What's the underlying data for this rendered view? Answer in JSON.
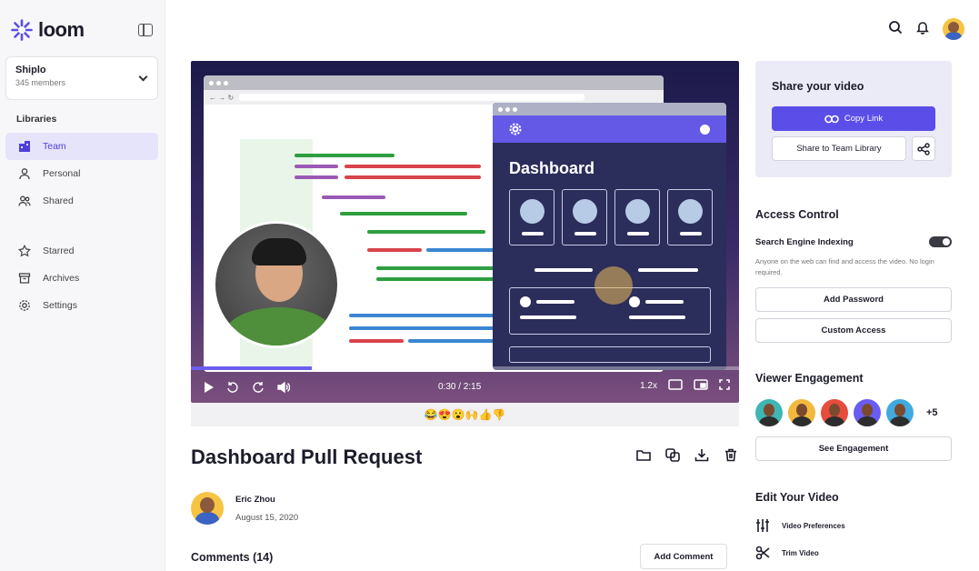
{
  "app": {
    "logo_text": "loom"
  },
  "workspace": {
    "name": "Shiplo",
    "members": "345 members"
  },
  "sidebar": {
    "libraries_label": "Libraries",
    "items": [
      {
        "label": "Team",
        "icon": "building-icon",
        "active": true
      },
      {
        "label": "Personal",
        "icon": "person-icon"
      },
      {
        "label": "Shared",
        "icon": "people-icon"
      },
      {
        "label": "Starred",
        "icon": "star-icon"
      },
      {
        "label": "Archives",
        "icon": "archive-icon"
      },
      {
        "label": "Settings",
        "icon": "gear-icon"
      }
    ]
  },
  "video": {
    "dashboard_title": "Dashboard",
    "time": "0:30 / 2:15",
    "speed": "1.2x",
    "progress": 0.22,
    "reactions": "😂😍😮🙌👍👎"
  },
  "page": {
    "title": "Dashboard Pull Request",
    "author": "Eric Zhou",
    "date": "August 15, 2020",
    "comments_label": "Comments (14)",
    "add_comment": "Add Comment"
  },
  "share": {
    "title": "Share your video",
    "copy_link": "Copy Link",
    "share_team": "Share to Team Library"
  },
  "access": {
    "heading": "Access Control",
    "indexing_label": "Search Engine Indexing",
    "indexing_desc": "Anyone on the web can find and access the video. No login required.",
    "add_password": "Add Password",
    "custom_access": "Custom Access"
  },
  "engagement": {
    "heading": "Viewer Engagement",
    "more": "+5",
    "see_button": "See Engagement",
    "viewer_colors": [
      "#3fb6b3",
      "#f3b93d",
      "#e74c3c",
      "#6a5cf0",
      "#3fa9e0"
    ]
  },
  "edit": {
    "heading": "Edit Your Video",
    "preferences": "Video Preferences",
    "trim": "Trim Video"
  },
  "colors": {
    "accent": "#5b4ee8",
    "active_bg": "#e5e4fb"
  }
}
